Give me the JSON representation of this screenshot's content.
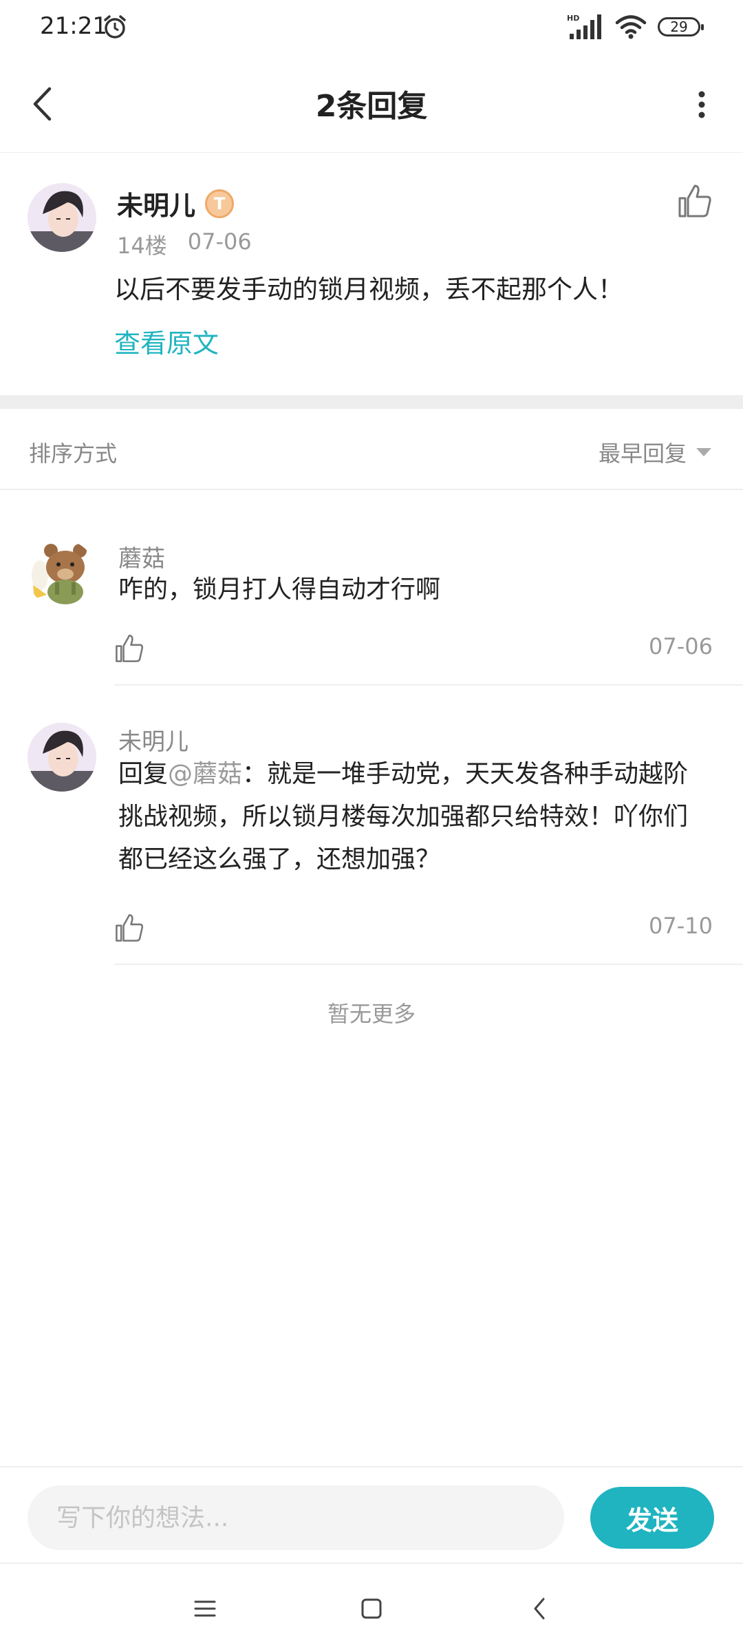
{
  "status_bar": {
    "time": "21:21",
    "battery": "29",
    "network_label": "HD"
  },
  "header": {
    "title": "2条回复"
  },
  "post": {
    "author": "未明儿",
    "level_badge": "T",
    "floor": "14楼",
    "date": "07-06",
    "content": "以后不要发手动的锁月视频，丢不起那个人！",
    "view_original": "查看原文"
  },
  "sort": {
    "label": "排序方式",
    "selected": "最早回复"
  },
  "replies": [
    {
      "author": "蘑菇",
      "text": "咋的，锁月打人得自动才行啊",
      "date": "07-06"
    },
    {
      "author": "未明儿",
      "prefix": "回复",
      "mention": "@蘑菇",
      "text": "：就是一堆手动党，天天发各种手动越阶挑战视频，所以锁月楼每次加强都只给特效！吖你们都已经这么强了，还想加强？",
      "date": "07-10"
    }
  ],
  "no_more": "暂无更多",
  "input": {
    "placeholder": "写下你的想法...",
    "value": "",
    "send_label": "发送"
  },
  "colors": {
    "accent": "#1fb4c0",
    "badge": "#f7c99a"
  },
  "icons": [
    "back-icon",
    "more-icon",
    "thumb-up-icon",
    "menu-icon",
    "home-icon",
    "back-nav-icon"
  ]
}
